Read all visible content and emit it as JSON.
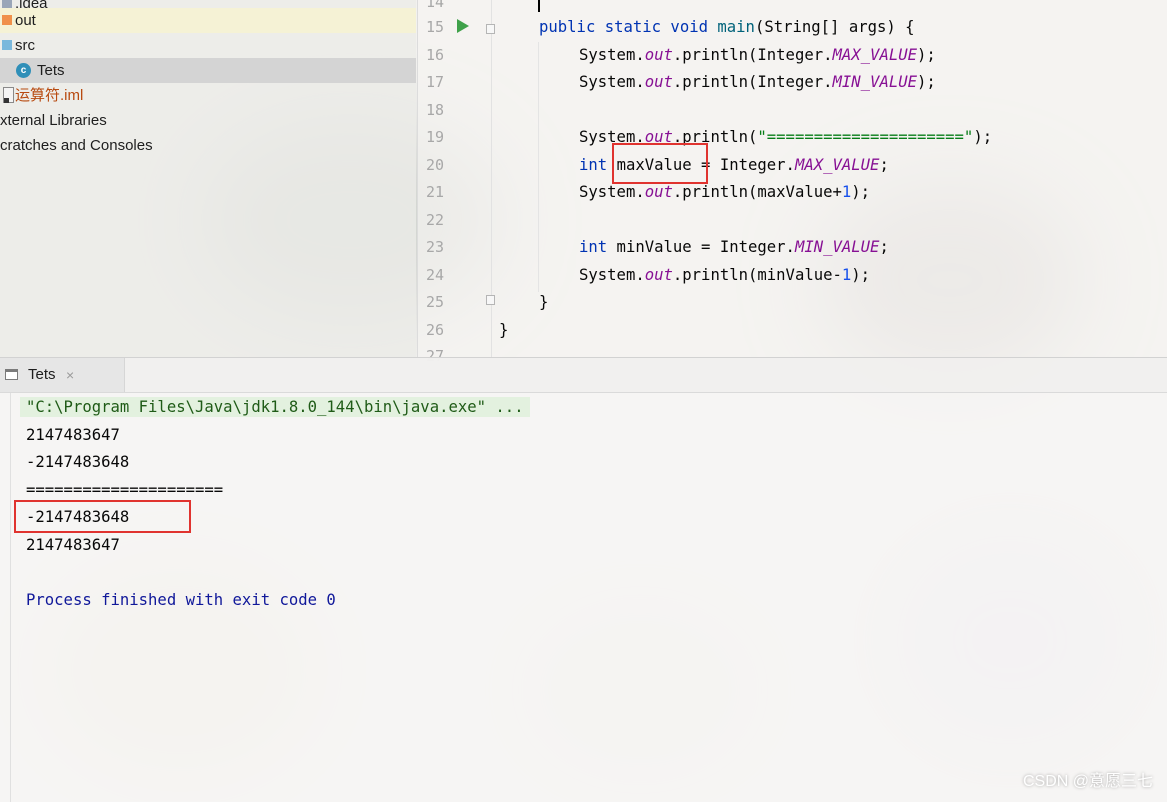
{
  "project_tree": {
    "items": [
      {
        "label": ".idea",
        "icon": "folder-icon"
      },
      {
        "label": "out",
        "icon": "folder-icon"
      },
      {
        "label": "src",
        "icon": "folder-icon"
      },
      {
        "label": "Tets",
        "icon": "java-class-icon"
      },
      {
        "label": "运算符.iml",
        "icon": "iml-file-icon"
      },
      {
        "label": "xternal Libraries",
        "icon": ""
      },
      {
        "label": "cratches and Consoles",
        "icon": ""
      }
    ]
  },
  "editor": {
    "line_numbers": [
      "14",
      "15",
      "16",
      "17",
      "18",
      "19",
      "20",
      "21",
      "22",
      "23",
      "24",
      "25",
      "26",
      "27"
    ],
    "code": {
      "l16_a": "System.",
      "l16_out": "out",
      "l16_b": ".println(Integer.",
      "l16_c": "MAX_VALUE",
      "l16_d": ");",
      "l17_a": "System.",
      "l17_out": "out",
      "l17_b": ".println(Integer.",
      "l17_c": "MIN_VALUE",
      "l17_d": ");",
      "l19_a": "System.",
      "l19_out": "out",
      "l19_b": ".println(",
      "l19_str": "\"=====================\"",
      "l19_d": ");",
      "l20_kw": "int",
      "l20_var": "maxValue",
      "l20_b": " = Integer.",
      "l20_c": "MAX_VALUE",
      "l20_d": ";",
      "l21_a": "System.",
      "l21_out": "out",
      "l21_b": ".println(maxValue+",
      "l21_num": "1",
      "l21_d": ");",
      "l23_kw": "int",
      "l23_b": " minValue = Integer.",
      "l23_c": "MIN_VALUE",
      "l23_d": ";",
      "l24_a": "System.",
      "l24_out": "out",
      "l24_b": ".println(minValue-",
      "l24_num": "1",
      "l24_d": ");",
      "l15_kw": "public static void ",
      "l15_fn": "main",
      "l15_rest": "(String[] args) {",
      "l25": "}",
      "l26": "}"
    }
  },
  "run_window": {
    "tab_label": "Tets",
    "tab_close": "×",
    "console": [
      "\"C:\\Program Files\\Java\\jdk1.8.0_144\\bin\\java.exe\" ...",
      "2147483647",
      "-2147483648",
      "=====================",
      "-2147483648",
      "2147483647",
      "Process finished with exit code 0"
    ]
  },
  "watermark": "CSDN @意愿三七"
}
